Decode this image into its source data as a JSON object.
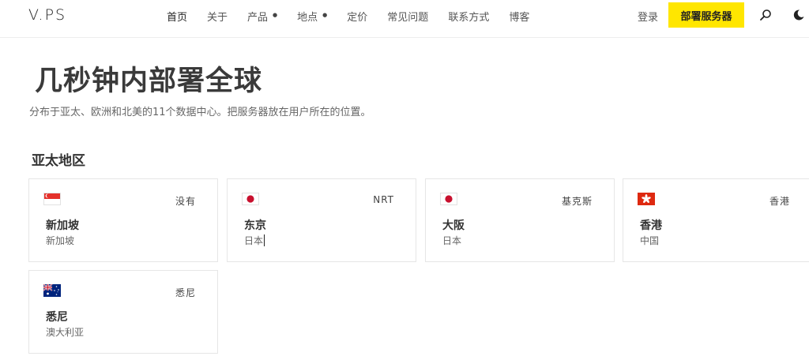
{
  "header": {
    "logo": "V.PS",
    "nav": [
      {
        "label": "首页",
        "dropdown": false
      },
      {
        "label": "关于",
        "dropdown": false
      },
      {
        "label": "产品",
        "dropdown": true
      },
      {
        "label": "地点",
        "dropdown": true
      },
      {
        "label": "定价",
        "dropdown": false
      },
      {
        "label": "常见问题",
        "dropdown": false
      },
      {
        "label": "联系方式",
        "dropdown": false
      },
      {
        "label": "博客",
        "dropdown": false
      }
    ],
    "login": "登录",
    "cta": "部署服务器",
    "icons": [
      "search-icon",
      "moon-icon"
    ],
    "accent_color": "#ffe600"
  },
  "hero": {
    "title": "几秒钟内部署全球",
    "subtitle": "分布于亚太、欧洲和北美的11个数据中心。把服务器放在用户所在的位置。"
  },
  "section": {
    "title": "亚太地区",
    "locations": [
      {
        "flag": "singapore-flag-icon",
        "code": "没有",
        "city": "新加坡",
        "country": "新加坡"
      },
      {
        "flag": "japan-flag-icon",
        "code": "NRT",
        "city": "东京",
        "country": "日本"
      },
      {
        "flag": "japan-flag-icon",
        "code": "基克斯",
        "city": "大阪",
        "country": "日本"
      },
      {
        "flag": "hong-kong-flag-icon",
        "code": "香港",
        "city": "香港",
        "country": "中国"
      },
      {
        "flag": "australia-flag-icon",
        "code": "悉尼",
        "city": "悉尼",
        "country": "澳大利亚"
      }
    ]
  }
}
